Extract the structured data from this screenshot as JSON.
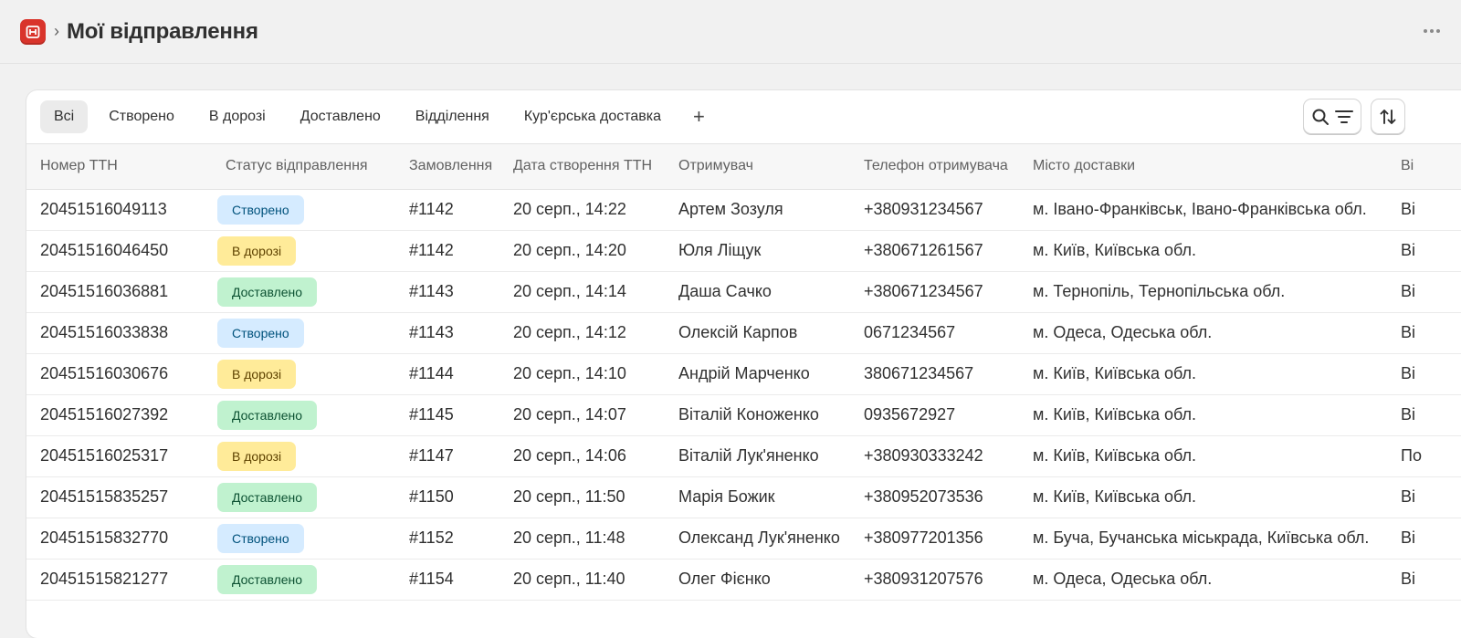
{
  "header": {
    "title": "Мої відправлення",
    "breadcrumb_separator": "›"
  },
  "tabs": [
    "Всі",
    "Створено",
    "В дорозі",
    "Доставлено",
    "Відділення",
    "Кур'єрська доставка"
  ],
  "active_tab": "Всі",
  "add_tab_label": "+",
  "toolbar_icons": [
    "search-icon",
    "filter-icon",
    "sort-icon"
  ],
  "colors": {
    "created_bg": "#d5ebff",
    "transit_bg": "#ffeb99",
    "delivered_bg": "#c0f2cf",
    "app_icon": "#d9342b"
  },
  "table": {
    "columns": [
      "Номер ТТН",
      "Статус відправлення",
      "Замовлення",
      "Дата створення ТТН",
      "Отримувач",
      "Телефон отримувача",
      "Місто доставки",
      "Ві"
    ],
    "rows": [
      {
        "ttn": "20451516049113",
        "status": "Створено",
        "status_type": "created",
        "order": "#1142",
        "date": "20 серп., 14:22",
        "recipient": "Артем Зозуля",
        "phone": "+380931234567",
        "city": "м. Івано-Франківськ, Івано-Франківська обл.",
        "extra": "Ві"
      },
      {
        "ttn": "20451516046450",
        "status": "В дорозі",
        "status_type": "transit",
        "order": "#1142",
        "date": "20 серп., 14:20",
        "recipient": "Юля Ліщук",
        "phone": "+380671261567",
        "city": "м. Київ, Київська обл.",
        "extra": "Ві"
      },
      {
        "ttn": "20451516036881",
        "status": "Доставлено",
        "status_type": "delivered",
        "order": "#1143",
        "date": "20 серп., 14:14",
        "recipient": "Даша Сачко",
        "phone": "+380671234567",
        "city": "м. Тернопіль, Тернопільська обл.",
        "extra": "Ві"
      },
      {
        "ttn": "20451516033838",
        "status": "Створено",
        "status_type": "created",
        "order": "#1143",
        "date": "20 серп., 14:12",
        "recipient": "Олексій Карпов",
        "phone": "0671234567",
        "city": "м. Одеса, Одеська обл.",
        "extra": "Ві"
      },
      {
        "ttn": "20451516030676",
        "status": "В дорозі",
        "status_type": "transit",
        "order": "#1144",
        "date": "20 серп., 14:10",
        "recipient": "Андрій Марченко",
        "phone": "380671234567",
        "city": "м. Київ, Київська обл.",
        "extra": "Ві"
      },
      {
        "ttn": "20451516027392",
        "status": "Доставлено",
        "status_type": "delivered",
        "order": "#1145",
        "date": "20 серп., 14:07",
        "recipient": "Віталій Коноженко",
        "phone": "0935672927",
        "city": "м. Київ, Київська обл.",
        "extra": "Ві"
      },
      {
        "ttn": "20451516025317",
        "status": "В дорозі",
        "status_type": "transit",
        "order": "#1147",
        "date": "20 серп., 14:06",
        "recipient": "Віталій Лук'яненко",
        "phone": "+380930333242",
        "city": "м. Київ, Київська обл.",
        "extra": "По"
      },
      {
        "ttn": "20451515835257",
        "status": "Доставлено",
        "status_type": "delivered",
        "order": "#1150",
        "date": "20 серп., 11:50",
        "recipient": "Марія Божик",
        "phone": "+380952073536",
        "city": "м. Київ, Київська обл.",
        "extra": "Ві"
      },
      {
        "ttn": "20451515832770",
        "status": "Створено",
        "status_type": "created",
        "order": "#1152",
        "date": "20 серп., 11:48",
        "recipient": "Олександ Лук'яненко",
        "phone": "+380977201356",
        "city": "м. Буча, Бучанська міськрада, Київська обл.",
        "extra": "Ві"
      },
      {
        "ttn": "20451515821277",
        "status": "Доставлено",
        "status_type": "delivered",
        "order": "#1154",
        "date": "20 серп., 11:40",
        "recipient": "Олег Фієнко",
        "phone": "+380931207576",
        "city": "м. Одеса, Одеська обл.",
        "extra": "Ві"
      }
    ]
  }
}
